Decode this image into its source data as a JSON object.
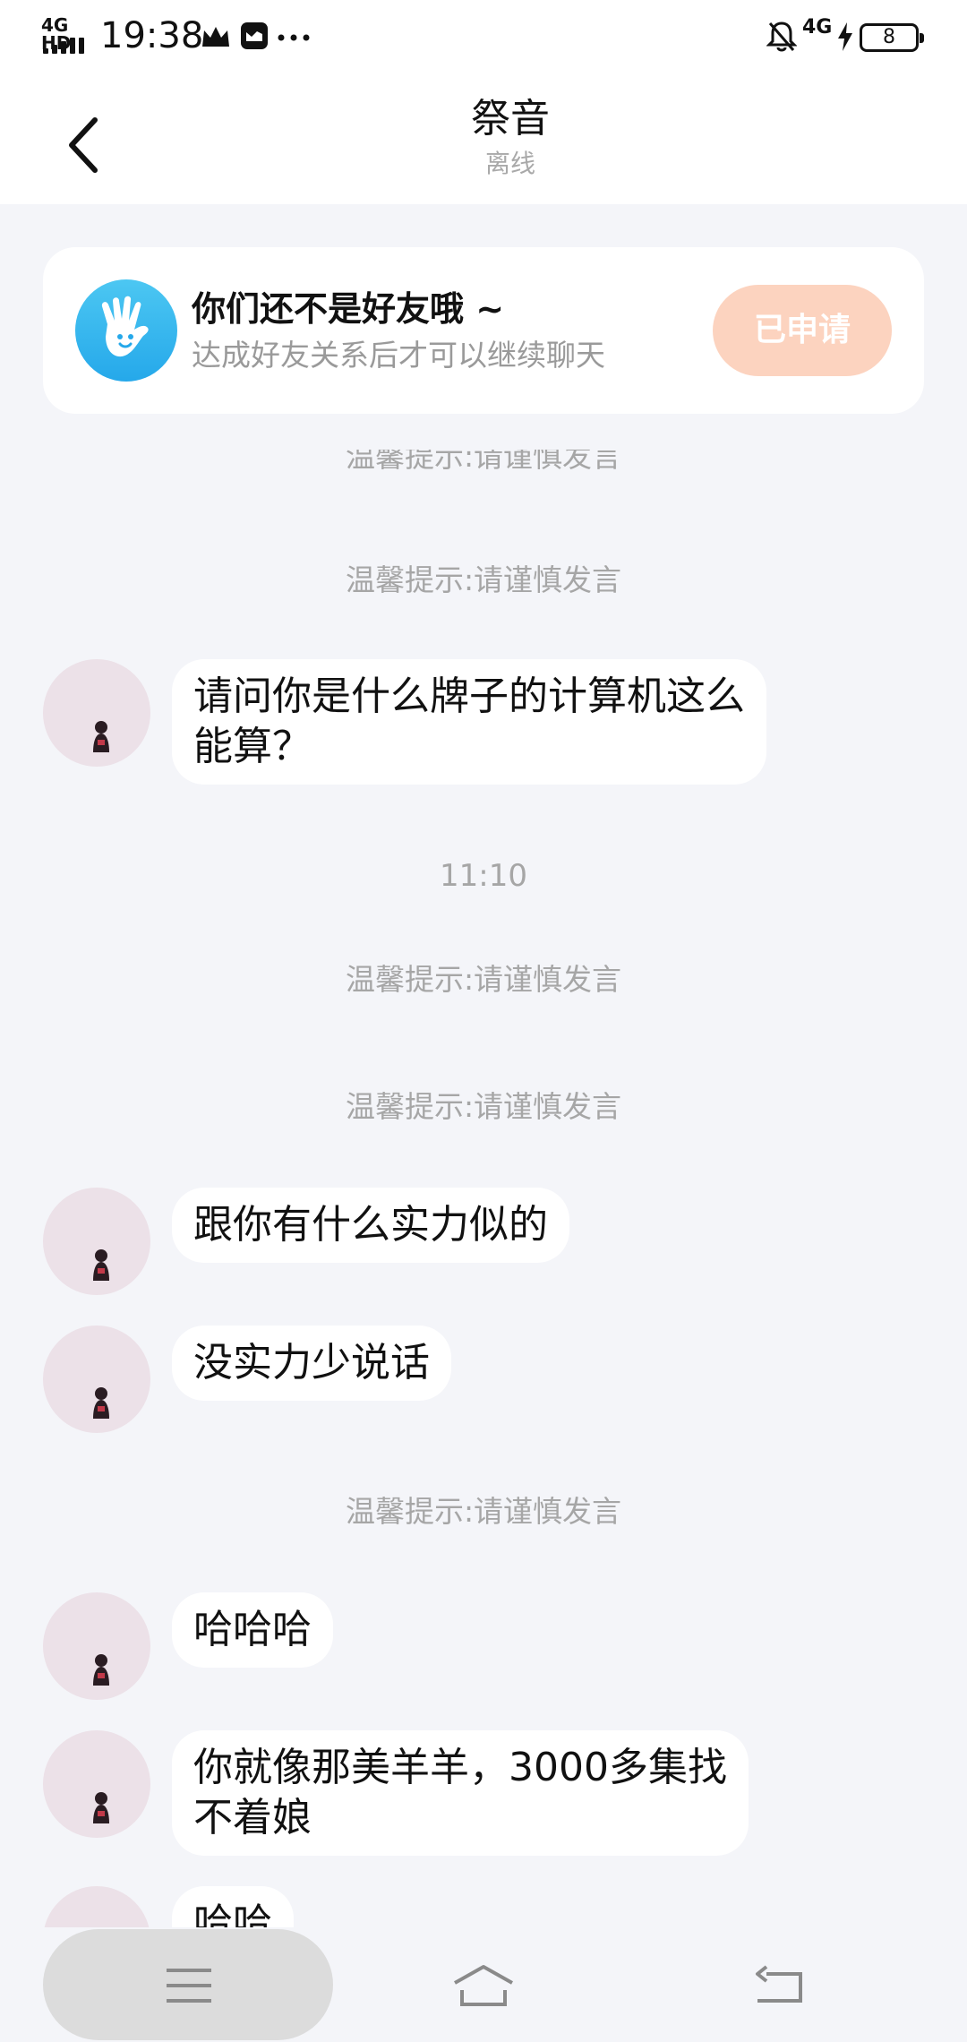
{
  "status_bar": {
    "network_label": "4G HD",
    "time": "19:38",
    "right_network": "4G",
    "battery": "8",
    "icons": [
      "crown-icon",
      "message-app-icon",
      "more-dots-icon",
      "bell-off-icon",
      "charging-icon"
    ]
  },
  "header": {
    "title": "祭音",
    "subtitle": "离线"
  },
  "friend_notice": {
    "title": "你们还不是好友哦 ~",
    "description": "达成好友关系后才可以继续聊天",
    "button_label": "已申请",
    "avatar_icon": "waving-hand-icon"
  },
  "chat": {
    "items": [
      {
        "kind": "notice",
        "text": "温馨提示:请谨慎发言"
      },
      {
        "kind": "notice",
        "text": "温馨提示:请谨慎发言"
      },
      {
        "kind": "message",
        "text": "请问你是什么牌子的计算机这么\n能算？"
      },
      {
        "kind": "time",
        "text": "11:10"
      },
      {
        "kind": "notice",
        "text": "温馨提示:请谨慎发言"
      },
      {
        "kind": "notice",
        "text": "温馨提示:请谨慎发言"
      },
      {
        "kind": "message",
        "text": "跟你有什么实力似的"
      },
      {
        "kind": "message",
        "text": "没实力少说话"
      },
      {
        "kind": "notice",
        "text": "温馨提示:请谨慎发言"
      },
      {
        "kind": "message",
        "text": "哈哈哈"
      },
      {
        "kind": "message",
        "text": "你就像那美羊羊，3000多集找\n不着娘"
      },
      {
        "kind": "message",
        "text": "哈哈"
      }
    ]
  },
  "nav_bar": {
    "icons": [
      "menu-icon",
      "home-icon",
      "back-icon"
    ]
  }
}
